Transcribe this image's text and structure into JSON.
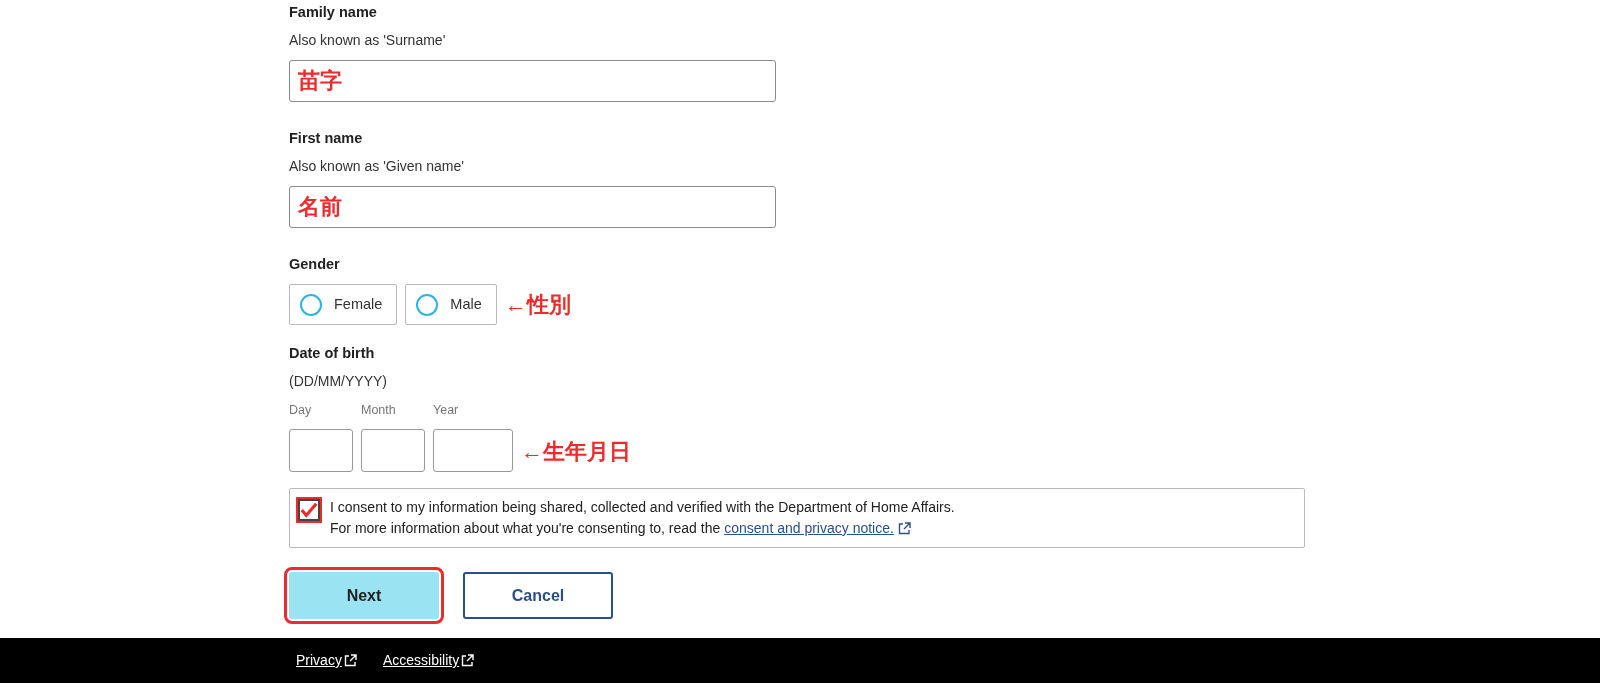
{
  "name_fields": [
    {
      "label": "Family name",
      "hint": "Also known as 'Surname'",
      "value": "苗字"
    },
    {
      "label": "First name",
      "hint": "Also known as 'Given name'",
      "value": "名前"
    }
  ],
  "gender": {
    "label": "Gender",
    "options": [
      {
        "label": "Female",
        "selected": false
      },
      {
        "label": "Male",
        "selected": false
      }
    ],
    "annotation": "←性別"
  },
  "date_of_birth": {
    "label": "Date of birth",
    "format": "(DD/MM/YYYY)",
    "parts": [
      {
        "label": "Day"
      },
      {
        "label": "Month"
      },
      {
        "label": "Year"
      }
    ],
    "annotation": "←生年月日"
  },
  "consent": {
    "checked": true,
    "highlighted": true,
    "line_1": "I consent to my information being shared, collected and verified with the Department of Home Affairs.",
    "line_2": "For more information about what you're consenting to, read the",
    "link": "consent and privacy notice."
  },
  "buttons": [
    {
      "label": "Next",
      "kind": "primary",
      "highlighted": true
    },
    {
      "label": "Cancel",
      "kind": "secondary",
      "highlighted": false
    }
  ],
  "footer_links": [
    "Privacy",
    "Accessibility"
  ]
}
